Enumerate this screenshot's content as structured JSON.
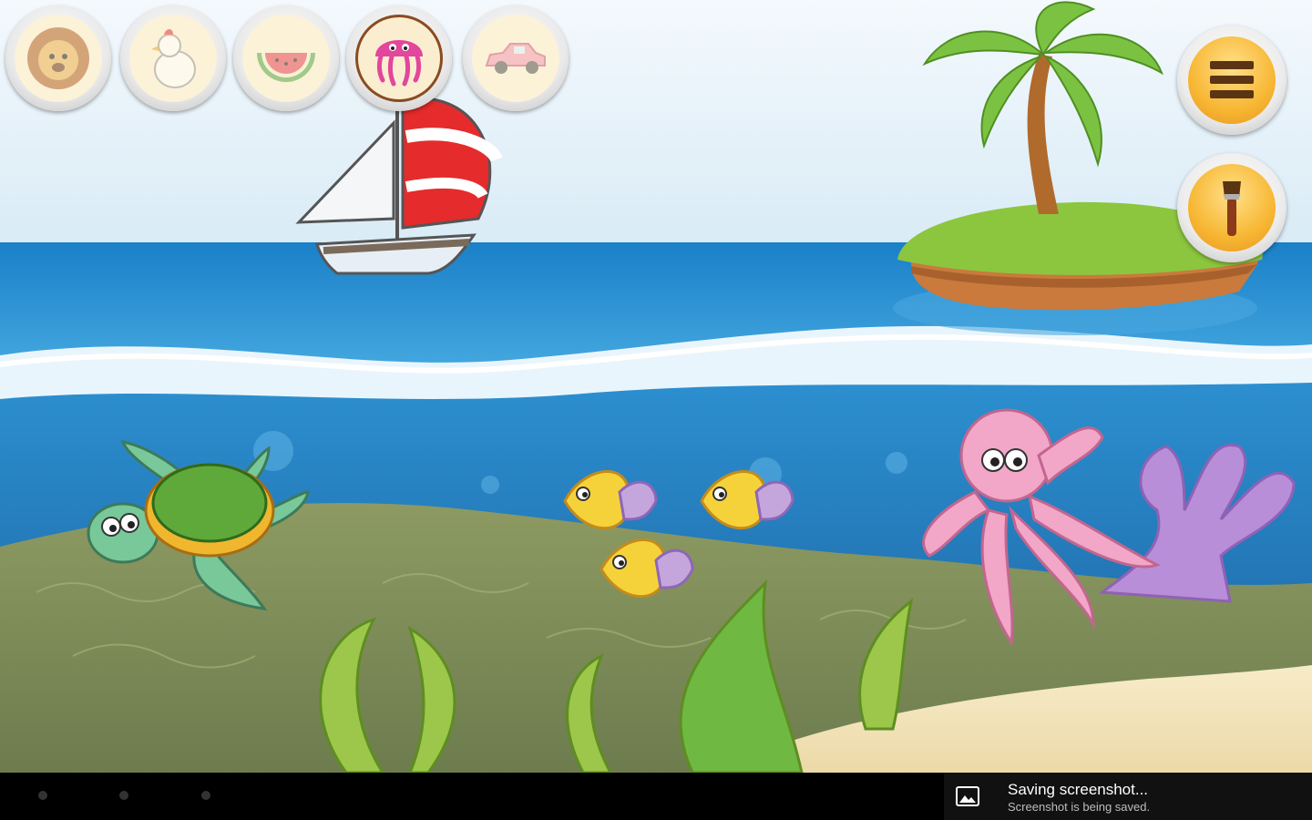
{
  "app": {
    "scene_name": "ocean"
  },
  "categories": [
    {
      "id": "animals",
      "icon": "lion-icon",
      "selected": false
    },
    {
      "id": "farm",
      "icon": "chicken-icon",
      "selected": false
    },
    {
      "id": "food",
      "icon": "watermelon-icon",
      "selected": false
    },
    {
      "id": "sea",
      "icon": "jellyfish-icon",
      "selected": true
    },
    {
      "id": "vehicles",
      "icon": "car-icon",
      "selected": false
    }
  ],
  "side_buttons": [
    {
      "id": "menu",
      "icon": "menu-icon"
    },
    {
      "id": "paint",
      "icon": "paintbrush-icon"
    }
  ],
  "scene_objects": [
    "sailboat",
    "palm-island",
    "turtle",
    "fish-school",
    "octopus",
    "coral",
    "seaweed"
  ],
  "colors": {
    "sky": "#e6f2fa",
    "sea": "#2f8fd0",
    "seabed": "#7f8f58",
    "sand": "#f3e4bd",
    "accent_gold": "#f7b733"
  },
  "notification": {
    "title": "Saving screenshot...",
    "subtitle": "Screenshot is being saved."
  }
}
